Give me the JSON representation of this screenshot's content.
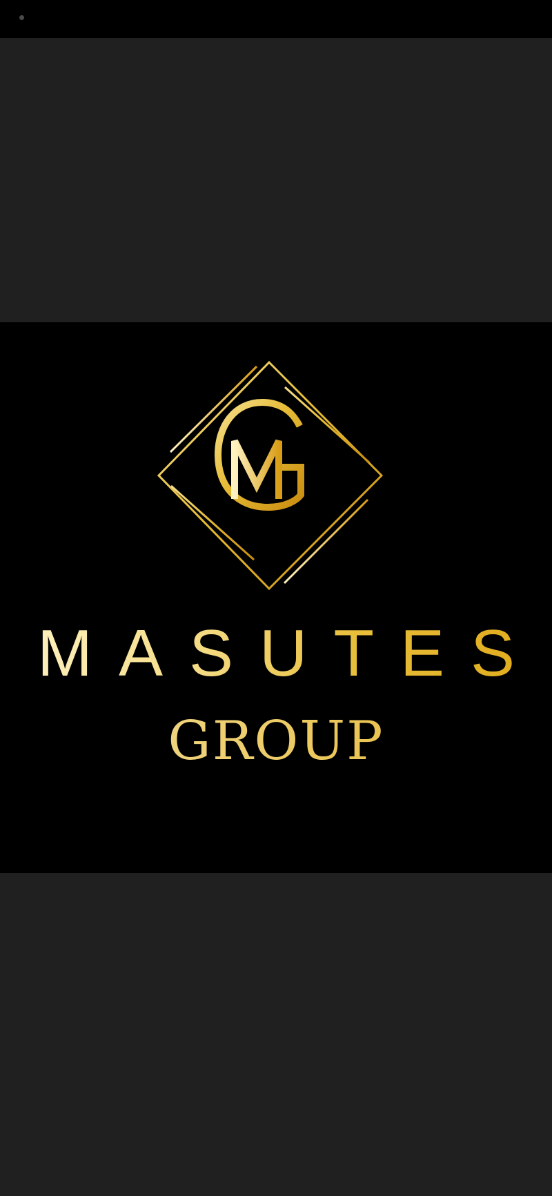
{
  "logo": {
    "monogram": "MG",
    "brand_name": "MASUTES",
    "brand_sub": "GROUP",
    "gold_light": "#fff4c8",
    "gold_mid": "#ecc85c",
    "gold_dark": "#e0a91a"
  },
  "colors": {
    "status_bar": "#000000",
    "backdrop": "#202020",
    "panel": "#000000"
  },
  "icons": {
    "status": "status-dot-icon",
    "emblem": "diamond-monogram-emblem"
  }
}
